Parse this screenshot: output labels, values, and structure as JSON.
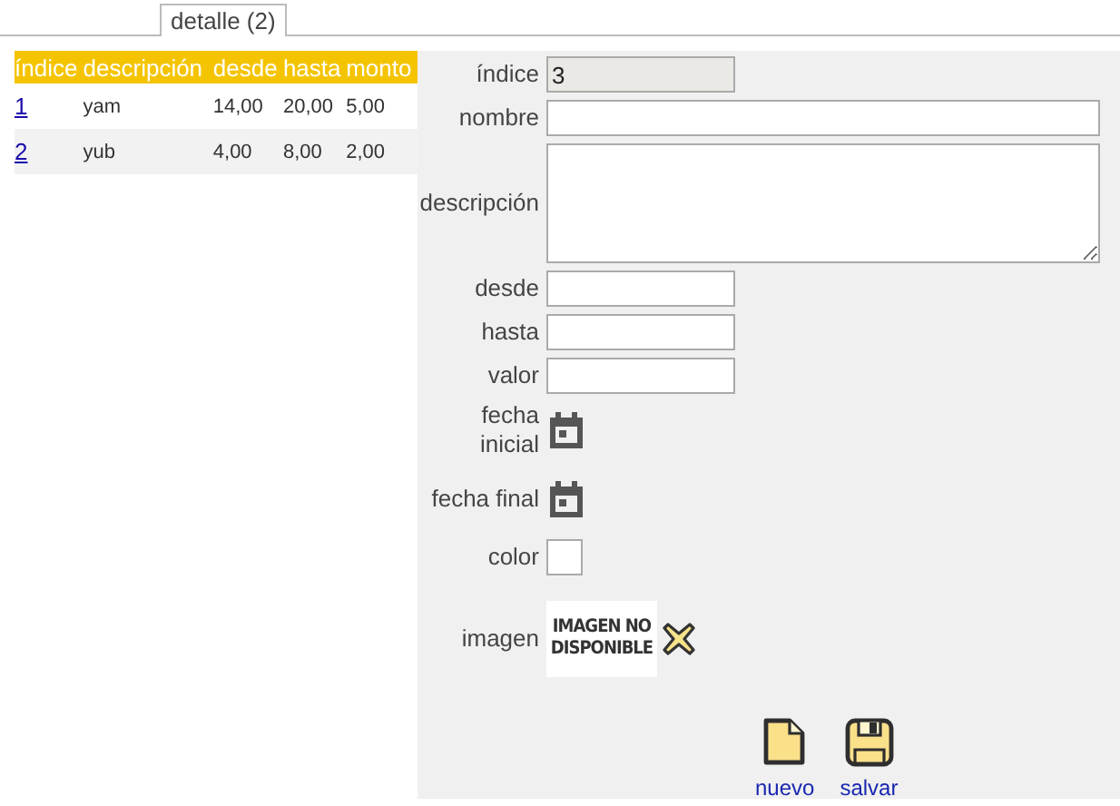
{
  "tabs": [
    {
      "label": "detalle (2)",
      "selected": true
    }
  ],
  "table": {
    "columns": [
      "índice",
      "descripción",
      "desde",
      "hasta",
      "monto"
    ],
    "rows": [
      {
        "cells": [
          "1",
          "yam",
          "14,00",
          "20,00",
          "5,00"
        ]
      },
      {
        "cells": [
          "2",
          "yub",
          "4,00",
          "8,00",
          "2,00"
        ]
      }
    ]
  },
  "form": {
    "fields": [
      {
        "kind": "text",
        "label": "índice",
        "value": "3",
        "disabled": true
      },
      {
        "kind": "wide_text",
        "label": "nombre",
        "disabled": false
      },
      {
        "kind": "textarea",
        "label": "descripción"
      },
      {
        "kind": "text",
        "label": "desde",
        "disabled": false
      },
      {
        "kind": "text",
        "label": "hasta",
        "disabled": false
      },
      {
        "kind": "text",
        "label": "valor",
        "disabled": false
      },
      {
        "kind": "date",
        "label": "fecha inicial"
      },
      {
        "kind": "date",
        "label": "fecha final"
      },
      {
        "kind": "color",
        "label": "color"
      },
      {
        "kind": "image",
        "label": "imagen",
        "image_text": "IMAGEN NO DISPONIBLE"
      }
    ],
    "actions": [
      {
        "kind": "new",
        "label": "nuevo"
      },
      {
        "kind": "save",
        "label": "salvar"
      }
    ]
  }
}
